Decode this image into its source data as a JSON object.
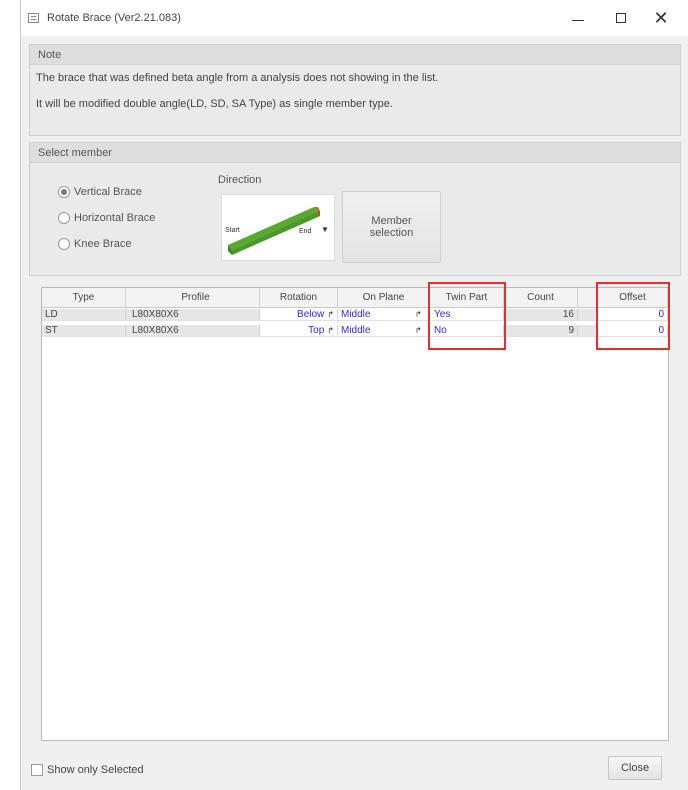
{
  "window": {
    "title": "Rotate Brace (Ver2.21.083)",
    "minimize": "–",
    "maximize": "□",
    "close": "✕"
  },
  "note": {
    "header": "Note",
    "line1": "The brace that was defined beta angle from a analysis does not showing in the list.",
    "line2": "It will be modified double angle(LD, SD, SA Type) as single member type."
  },
  "select_member": {
    "header": "Select member",
    "options": [
      {
        "label": "Vertical Brace",
        "checked": true
      },
      {
        "label": "Horizontal Brace",
        "checked": false
      },
      {
        "label": "Knee Brace",
        "checked": false
      }
    ],
    "direction_label": "Direction",
    "direction_start": "Start",
    "direction_end": "End",
    "direction_caret": "▼",
    "member_selection_button": "Member\nselection"
  },
  "grid": {
    "columns": [
      "Type",
      "Profile",
      "Rotation",
      "On Plane",
      "Twin Part",
      "Count",
      "",
      "Offset"
    ],
    "rows": [
      {
        "type": "LD",
        "profile": "L80X80X6",
        "rotation": "Below",
        "on_plane": "Middle",
        "twin_part": "Yes",
        "count": "16",
        "offset": "0"
      },
      {
        "type": "ST",
        "profile": "L80X80X6",
        "rotation": "Top",
        "on_plane": "Middle",
        "twin_part": "No",
        "count": "9",
        "offset": "0"
      }
    ],
    "dropdown_glyph": "↱"
  },
  "footer": {
    "show_only_selected": "Show only Selected",
    "close_button": "Close"
  },
  "colors": {
    "highlight": "#e03030",
    "editable_text": "#2a2aff",
    "brace_green": "#5aa832",
    "brace_end": "#d2691e"
  }
}
